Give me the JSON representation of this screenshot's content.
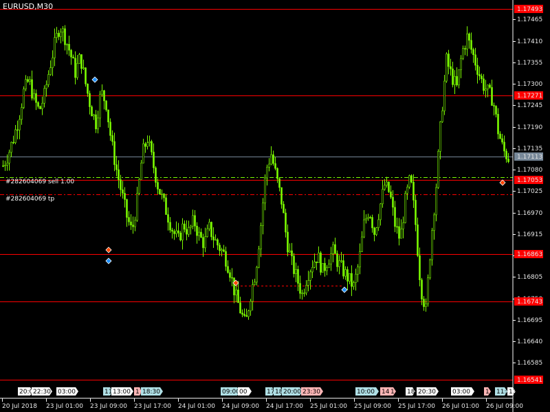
{
  "chart": {
    "symbol_timeframe": "EURUSD,M30",
    "background": "#000000",
    "candle_color": "#7CFC00",
    "level_line_color": "#ff0000",
    "bid_line_color": "#778899"
  },
  "chart_data": {
    "type": "candlestick",
    "ylim": [
      1.16515,
      1.17508
    ],
    "price_ticks": [
      "1.17465",
      "1.17410",
      "1.17355",
      "1.17300",
      "1.17245",
      "1.17190",
      "1.17135",
      "1.17080",
      "1.17025",
      "1.16970",
      "1.16915",
      "1.16860",
      "1.16805",
      "1.16750",
      "1.16695",
      "1.16640",
      "1.16585"
    ],
    "time_ticks": [
      "20 Jul 2018",
      "23 Jul 01:00",
      "23 Jul 09:00",
      "23 Jul 17:00",
      "24 Jul 01:00",
      "24 Jul 09:00",
      "24 Jul 17:00",
      "25 Jul 01:00",
      "25 Jul 09:00",
      "25 Jul 17:00",
      "26 Jul 01:00",
      "26 Jul 09:00"
    ],
    "close_path": [
      1.1709,
      1.1712,
      1.1716,
      1.1721,
      1.1728,
      1.1731,
      1.1726,
      1.1723,
      1.1727,
      1.1734,
      1.174,
      1.1745,
      1.1742,
      1.1738,
      1.1733,
      1.1737,
      1.173,
      1.1724,
      1.172,
      1.1728,
      1.1725,
      1.1715,
      1.1708,
      1.1702,
      1.1696,
      1.1692,
      1.17,
      1.1712,
      1.1716,
      1.171,
      1.1704,
      1.17,
      1.1696,
      1.1692,
      1.169,
      1.1694,
      1.1692,
      1.1695,
      1.1691,
      1.1689,
      1.1693,
      1.169,
      1.1688,
      1.1686,
      1.1682,
      1.1676,
      1.1672,
      1.1668,
      1.1676,
      1.1682,
      1.1694,
      1.1708,
      1.1712,
      1.1706,
      1.17,
      1.169,
      1.1684,
      1.168,
      1.1676,
      1.1681,
      1.1684,
      1.1686,
      1.1682,
      1.1685,
      1.1687,
      1.1684,
      1.1682,
      1.168,
      1.1678,
      1.1684,
      1.1694,
      1.1698,
      1.1692,
      1.1698,
      1.1704,
      1.1702,
      1.1694,
      1.169,
      1.17,
      1.1706,
      1.1694,
      1.1678,
      1.1672,
      1.169,
      1.1704,
      1.1722,
      1.1736,
      1.1732,
      1.1729,
      1.1738,
      1.1742,
      1.1738,
      1.1734,
      1.173,
      1.1728,
      1.1726,
      1.1718,
      1.1713,
      1.1711
    ],
    "horizontal_levels": [
      {
        "price": "1.17493",
        "type": "level"
      },
      {
        "price": "1.17271",
        "type": "level"
      },
      {
        "price": "1.17113",
        "type": "bid"
      },
      {
        "price": "1.17053",
        "type": "level"
      },
      {
        "price": "1.16863",
        "type": "level"
      },
      {
        "price": "1.16743",
        "type": "level"
      },
      {
        "price": "1.16541",
        "type": "level"
      }
    ],
    "trade_lines": [
      {
        "price": 1.1706,
        "label": "#282604069 sell 1.00",
        "color": "#7CFC00"
      },
      {
        "price": 1.17016,
        "label": "#282604069 tp",
        "color": "#ff0000"
      }
    ]
  },
  "axis_labels": {
    "highlighted_prices": [
      {
        "text": "1.17493",
        "bg": "#ff0000"
      },
      {
        "text": "1.17271",
        "bg": "#ff0000"
      },
      {
        "text": "1.17113",
        "bg": "#778899"
      },
      {
        "text": "1.17053",
        "bg": "#ff0000"
      },
      {
        "text": "1.16863",
        "bg": "#ff0000"
      },
      {
        "text": "1.16743",
        "bg": "#ff0000"
      },
      {
        "text": "1.16541",
        "bg": "#ff0000"
      }
    ]
  },
  "session_tags": [
    {
      "text": "20:0",
      "bg": "#ffffff"
    },
    {
      "text": "22:30",
      "bg": "#ffffff"
    },
    {
      "text": "03:00",
      "bg": "#ffffff"
    },
    {
      "text": "11",
      "bg": "#b0e0e6"
    },
    {
      "text": "13:00",
      "bg": "#ffffff"
    },
    {
      "text": "17",
      "bg": "#ffb6b6"
    },
    {
      "text": "18:30",
      "bg": "#b0e0e6"
    },
    {
      "text": "09:00",
      "bg": "#b0e0e6"
    },
    {
      "text": "00",
      "bg": "#ffffff"
    },
    {
      "text": "17",
      "bg": "#b0e0e6"
    },
    {
      "text": "18",
      "bg": "#b0e0e6"
    },
    {
      "text": "20:00",
      "bg": "#b0e0e6"
    },
    {
      "text": "23:30",
      "bg": "#ffb6b6"
    },
    {
      "text": "10:00",
      "bg": "#b0e0e6"
    },
    {
      "text": "14:",
      "bg": "#ffb6b6"
    },
    {
      "text": "1",
      "bg": "#ffb6b6"
    },
    {
      "text": "18",
      "bg": "#ffffff"
    },
    {
      "text": "20:30",
      "bg": "#ffffff"
    },
    {
      "text": "03:00",
      "bg": "#ffffff"
    },
    {
      "text": "1",
      "bg": "#ffb6b6"
    },
    {
      "text": "11:",
      "bg": "#b0e0e6"
    },
    {
      "text": "13",
      "bg": "#ffffff"
    }
  ],
  "trade_markers": [
    {
      "kind": "entry",
      "color": "#1e90ff"
    },
    {
      "kind": "exit",
      "color": "#ff4500"
    },
    {
      "kind": "entry",
      "color": "#1e90ff"
    },
    {
      "kind": "exit",
      "color": "#ff4500"
    },
    {
      "kind": "entry",
      "color": "#1e90ff"
    },
    {
      "kind": "exit",
      "color": "#ff4500"
    }
  ]
}
